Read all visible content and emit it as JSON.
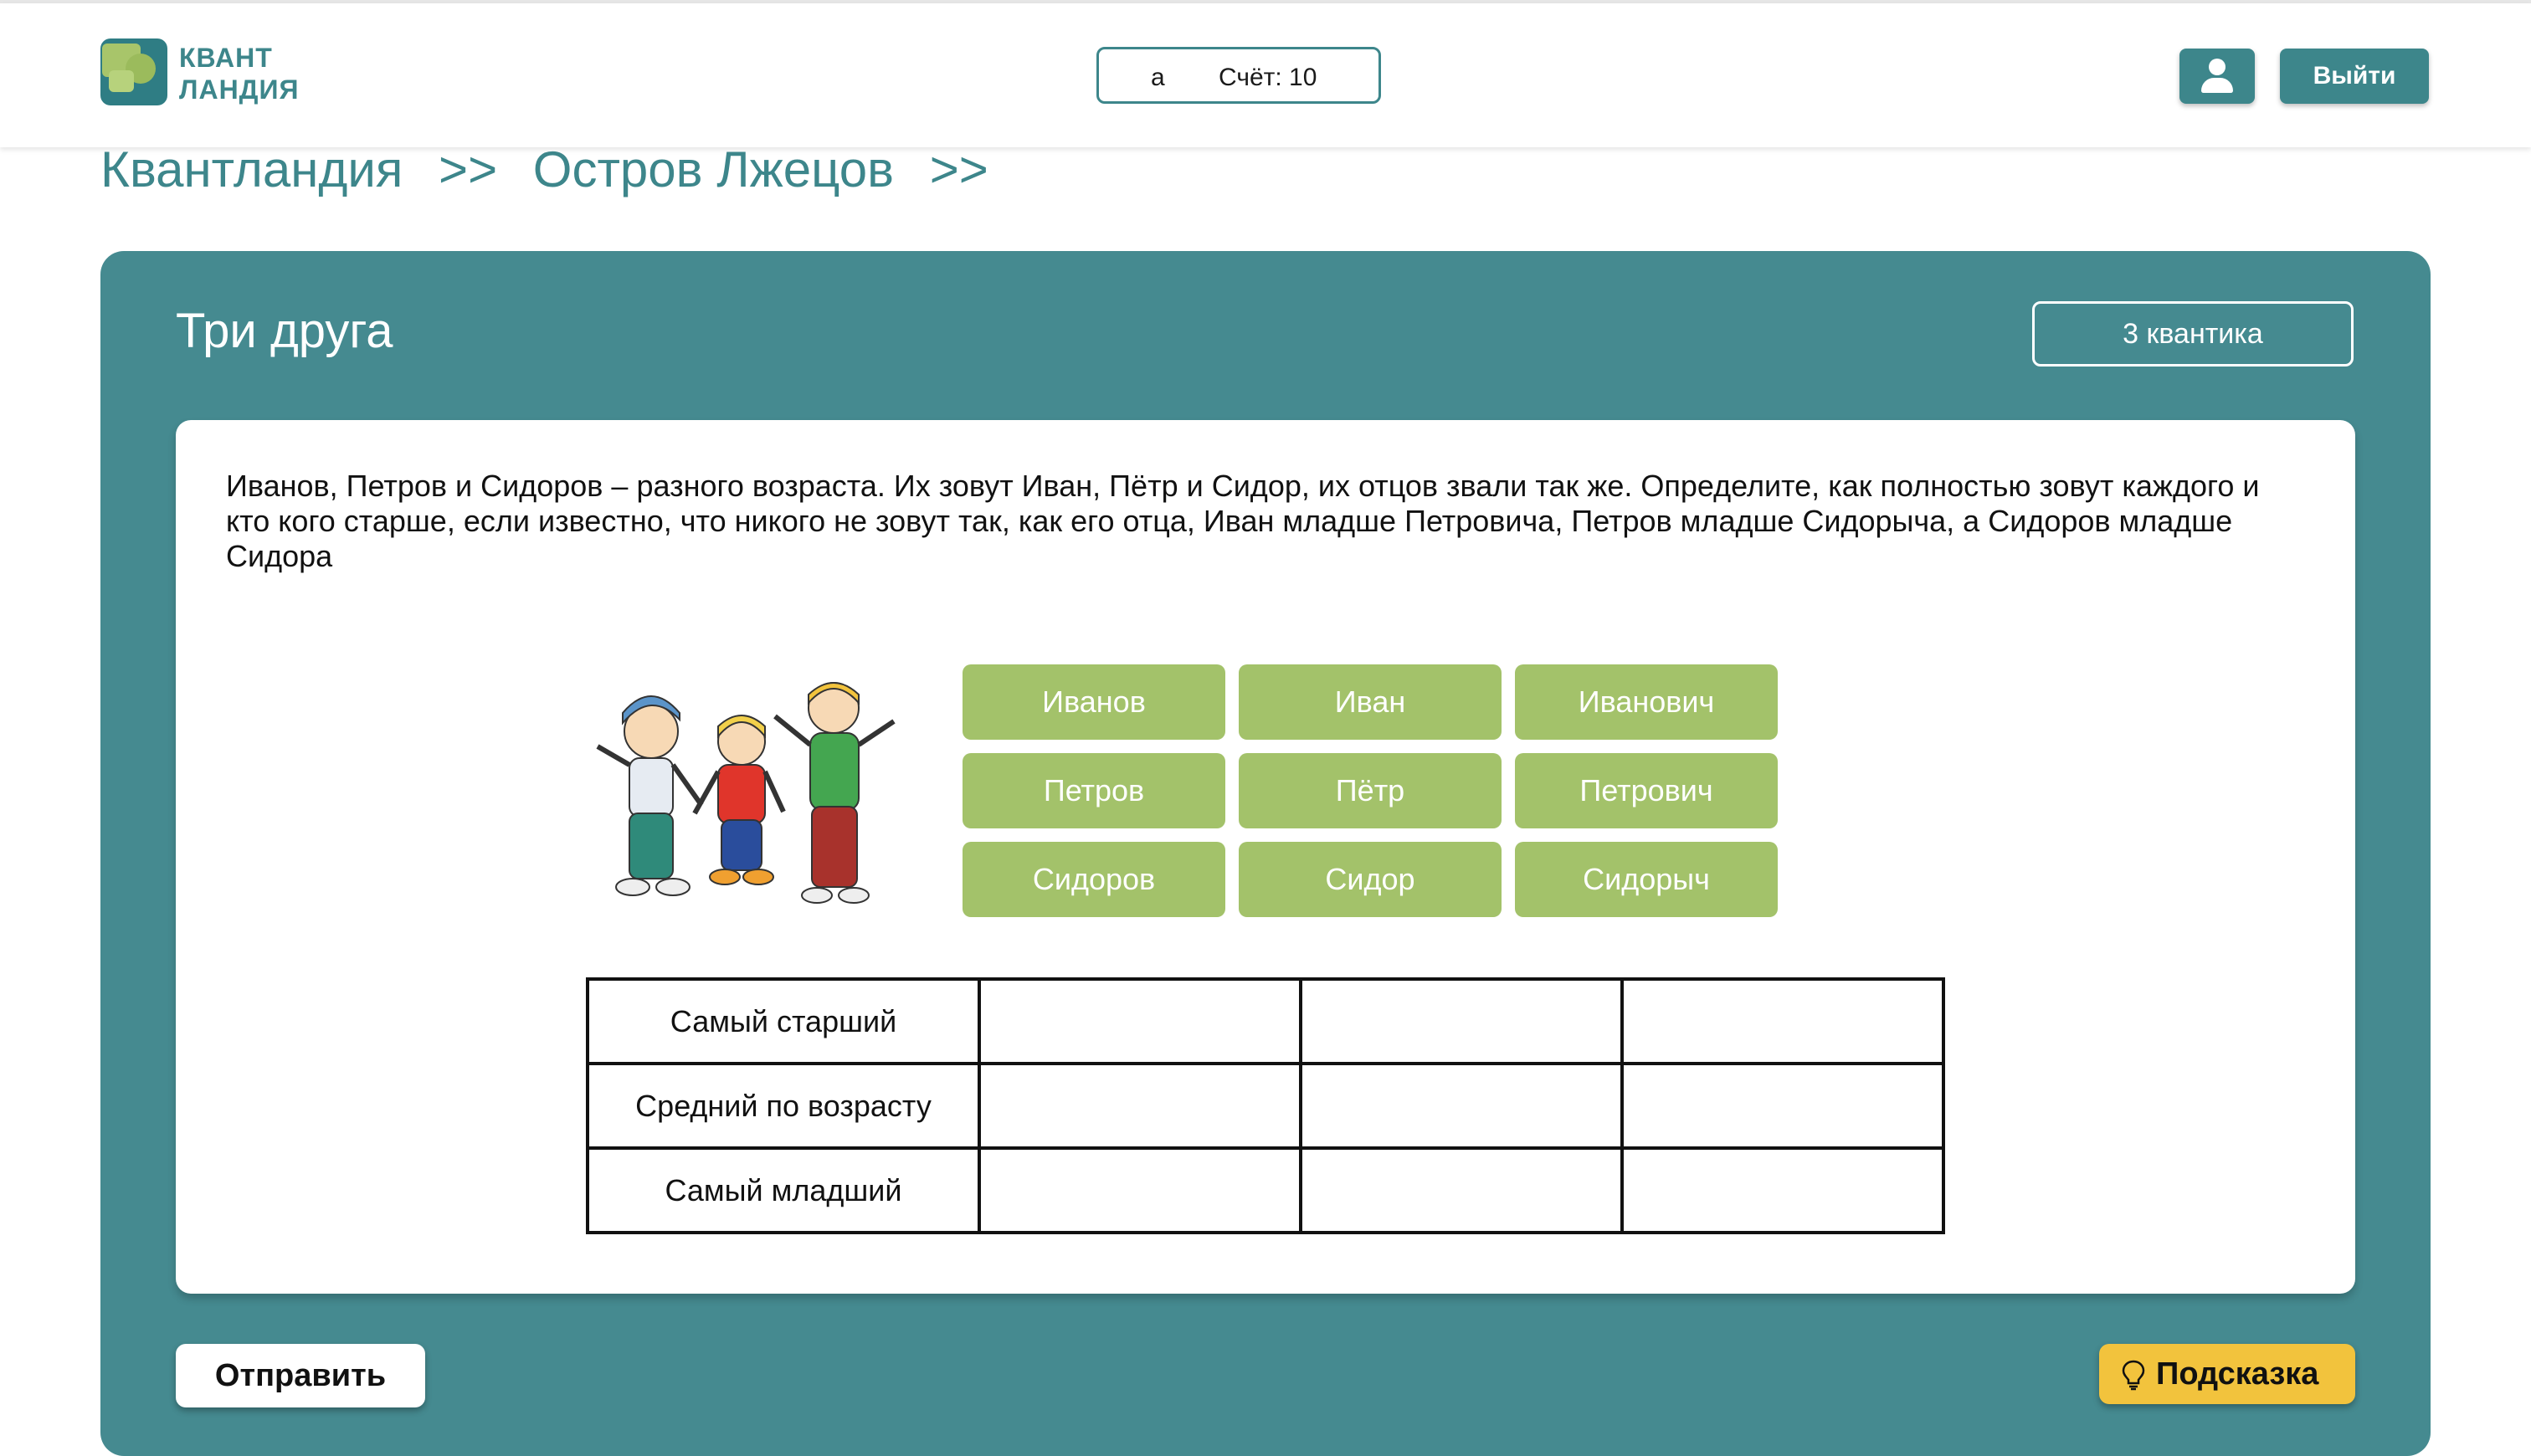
{
  "header": {
    "logo_line1": "КВАНТ",
    "logo_line2": "ЛАНДИЯ",
    "user_name": "а",
    "score_text": "Счёт: 10",
    "profile_icon": "user-icon",
    "exit_label": "Выйти"
  },
  "breadcrumb": {
    "items": [
      "Квантландия",
      "Остров Лжецов"
    ],
    "separator": ">>"
  },
  "task": {
    "title": "Три друга",
    "points": "3 квантика",
    "text": "Иванов, Петров и Сидоров – разного возраста. Их зовут Иван, Пётр и Сидор, их отцов звали так же. Определите, как полностью зовут каждого и кто кого старше, если известно, что никого не зовут так, как его отца, Иван младше Петровича, Петров младше Сидорыча, а Сидоров младше Сидора",
    "image": "three-kids-illustration",
    "tiles": [
      [
        "Иванов",
        "Иван",
        "Иванович"
      ],
      [
        "Петров",
        "Пётр",
        "Петрович"
      ],
      [
        "Сидоров",
        "Сидор",
        "Сидорыч"
      ]
    ],
    "rows": [
      "Самый старший",
      "Средний по возрасту",
      "Самый младший"
    ]
  },
  "actions": {
    "submit_label": "Отправить",
    "hint_label": "Подсказка",
    "hint_icon": "lightbulb-icon"
  },
  "colors": {
    "teal": "#458a90",
    "tile_green": "#a3c26a",
    "hint_yellow": "#f2c33d"
  }
}
